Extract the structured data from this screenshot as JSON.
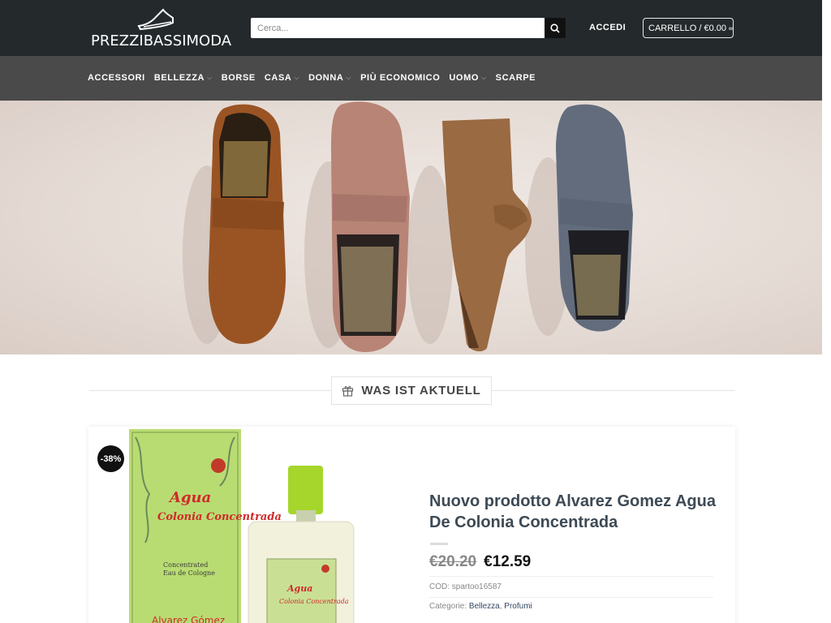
{
  "header": {
    "logo_text": "PREZZIBASSIMODA",
    "search_placeholder": "Cerca...",
    "login_label": "ACCEDI",
    "cart_label": "CARRELLO / €0.00"
  },
  "nav": {
    "items": [
      {
        "label": "ACCESSORI",
        "dropdown": false
      },
      {
        "label": "BELLEZZA",
        "dropdown": true
      },
      {
        "label": "BORSE",
        "dropdown": false
      },
      {
        "label": "CASA",
        "dropdown": true
      },
      {
        "label": "DONNA",
        "dropdown": true
      },
      {
        "label": "PIÙ ECONOMICO",
        "dropdown": false
      },
      {
        "label": "UOMO",
        "dropdown": true
      },
      {
        "label": "SCARPE",
        "dropdown": false
      }
    ]
  },
  "section": {
    "title": "WAS IST AKTUELL"
  },
  "product": {
    "badge": "-38%",
    "title": "Nuovo prodotto Alvarez Gomez Agua De Colonia Concentrada",
    "price_old": "€20.20",
    "price_new": "€12.59",
    "sku_label": "COD:",
    "sku": "spartoo16587",
    "categories_label": "Categorie:",
    "categories": [
      "Bellezza",
      "Profumi"
    ],
    "image_text": {
      "box_brand": "Agua de Colonia Concentrada",
      "box_sub": "Concentrated Eau de Cologne",
      "box_maker": "Alvarez Gómez"
    }
  },
  "colors": {
    "header_bg": "#242a2c",
    "nav_bg": "#4a4a4a",
    "title_color": "#3d4a55",
    "box_green": "#b8dc72",
    "cap_green": "#a6d62c"
  }
}
